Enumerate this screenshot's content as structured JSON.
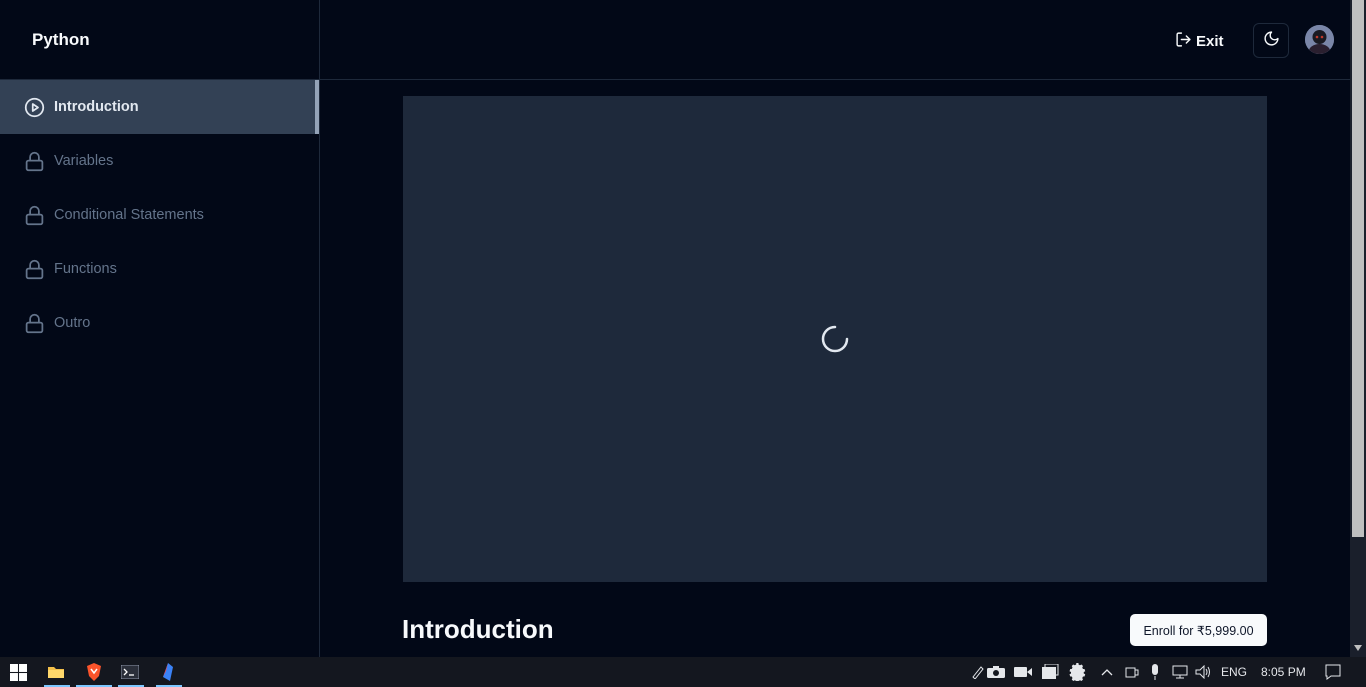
{
  "sidebar": {
    "course_title": "Python",
    "items": [
      {
        "label": "Introduction",
        "icon": "play-circle-icon",
        "active": true
      },
      {
        "label": "Variables",
        "icon": "lock-icon",
        "active": false
      },
      {
        "label": "Conditional Statements",
        "icon": "lock-icon",
        "active": false
      },
      {
        "label": "Functions",
        "icon": "lock-icon",
        "active": false
      },
      {
        "label": "Outro",
        "icon": "lock-icon",
        "active": false
      }
    ]
  },
  "header": {
    "exit_label": "Exit",
    "theme_icon": "moon-icon",
    "avatar_icon": "user-avatar"
  },
  "main": {
    "lesson_title": "Introduction",
    "enroll_label": "Enroll for ₹5,999.00",
    "video_state": "loading"
  },
  "taskbar": {
    "apps": [
      "windows-start-icon",
      "file-explorer-icon",
      "brave-browser-icon",
      "terminal-icon",
      "app-icon"
    ],
    "language": "ENG",
    "time": "8:05 PM"
  },
  "colors": {
    "background": "#020817",
    "sidebar_active": "#334155",
    "video_bg": "#1e293b",
    "text_primary": "#f8fafc",
    "text_muted": "#64748b"
  }
}
